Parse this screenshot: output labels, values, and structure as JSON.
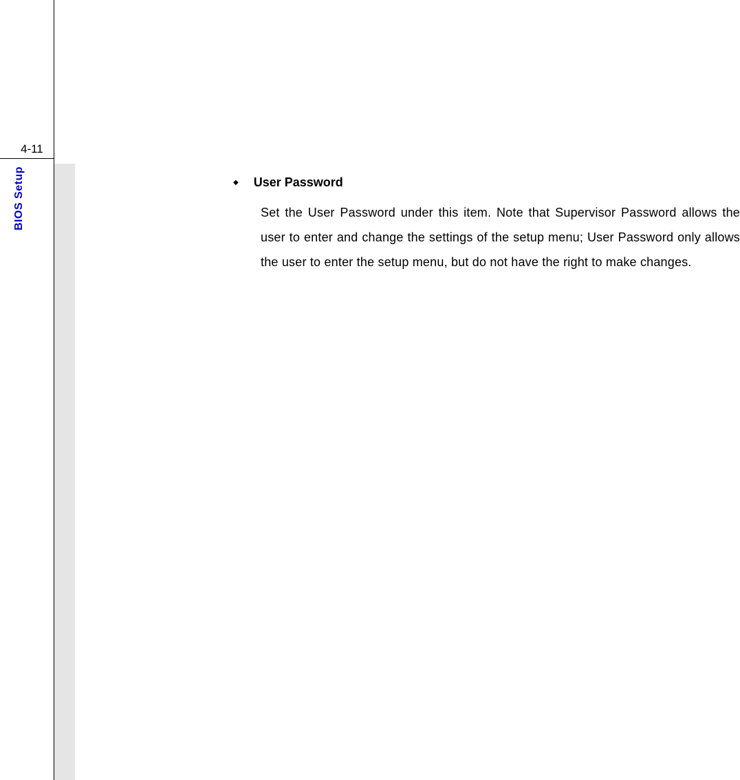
{
  "page": {
    "number": "4-11",
    "section_label": "BIOS Setup"
  },
  "content": {
    "bullet_title": "User Password",
    "body_text": "Set the User Password under this item.  Note that Supervisor Password allows the user to enter and change the settings of the setup menu; User Password only allows the user to enter the setup menu, but do not have the right to make changes."
  }
}
